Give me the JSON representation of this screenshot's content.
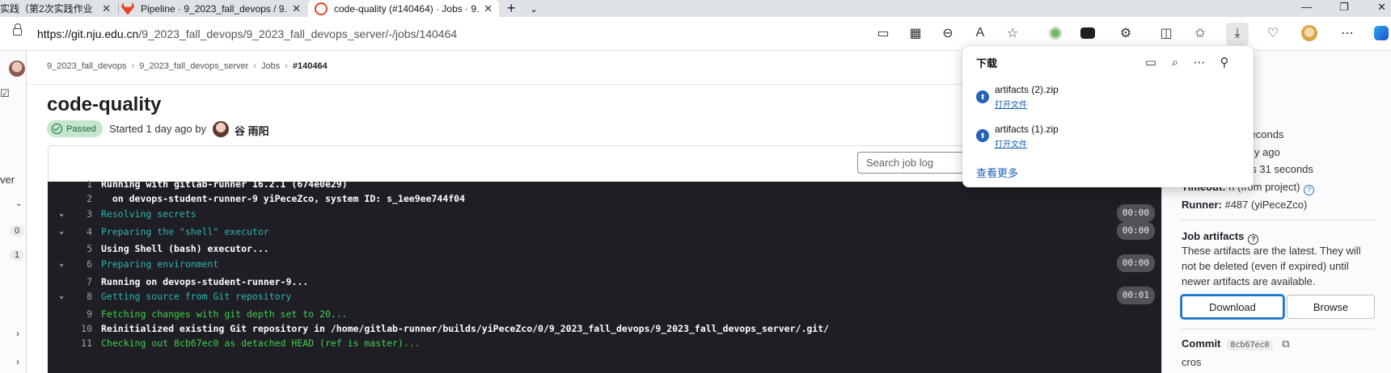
{
  "browser": {
    "tabs": [
      {
        "title": "实践（第2次实践作业",
        "icon_color": "#d9534f"
      },
      {
        "title": "Pipeline · 9_2023_fall_devops / 9.",
        "icon_color": "#e24329"
      },
      {
        "title": "code-quality (#140464) · Jobs · 9.",
        "icon_color": "#e24329",
        "active": true
      }
    ],
    "new_tab_label": "+",
    "tab_list_label": "⌄",
    "url_host": "https://git.nju.edu.cn",
    "url_path": "/9_2023_fall_devops/9_2023_fall_devops_server/-/jobs/140464",
    "toolbar_icons": [
      "app-available-icon",
      "qr-code-icon",
      "zoom-out-icon",
      "read-aloud-icon",
      "favorite-star-icon",
      "extension-green-icon",
      "extension-mask-icon",
      "extensions-icon",
      "split-screen-icon",
      "favorites-icon",
      "downloads-icon",
      "browser-essentials-icon",
      "profile-icon",
      "more-icon",
      "copilot-icon"
    ]
  },
  "sidebar": {
    "labels": [
      "ver"
    ],
    "badges": [
      "0",
      "1"
    ]
  },
  "breadcrumb": [
    "9_2023_fall_devops",
    "9_2023_fall_devops_server",
    "Jobs",
    "#140464"
  ],
  "job": {
    "title": "code-quality",
    "status": "Passed",
    "started": "Started 1 day ago by",
    "user": "谷 雨阳",
    "search_placeholder": "Search job log"
  },
  "log_lines": [
    {
      "n": "1",
      "text": "Running with gitlab-runner 16.2.1 (674e0e29)",
      "style": "bld"
    },
    {
      "n": "2",
      "text": "  on devops-student-runner-9 yiPeceZco, system ID: s_1ee9ee744f04",
      "style": "bld"
    },
    {
      "n": "3",
      "text": "Resolving secrets",
      "style": "sec",
      "dur": "00:00",
      "collapsible": true
    },
    {
      "n": "4",
      "text": "Preparing the \"shell\" executor",
      "style": "sec",
      "dur": "00:00",
      "collapsible": true
    },
    {
      "n": "5",
      "text": "Using Shell (bash) executor...",
      "style": "bld"
    },
    {
      "n": "6",
      "text": "Preparing environment",
      "style": "sec",
      "dur": "00:00",
      "collapsible": true
    },
    {
      "n": "7",
      "text": "Running on devops-student-runner-9...",
      "style": "bld"
    },
    {
      "n": "8",
      "text": "Getting source from Git repository",
      "style": "sec",
      "dur": "00:01",
      "collapsible": true
    },
    {
      "n": "9",
      "text": "Fetching changes with git depth set to 20...",
      "style": "grn"
    },
    {
      "n": "10",
      "text": "Reinitialized existing Git repository in /home/gitlab-runner/builds/yiPeceZco/0/9_2023_fall_devops/9_2023_fall_devops_server/.git/",
      "style": "bld"
    },
    {
      "n": "11",
      "text": "Checking out 8cb67ec0 as detached HEAD (ref is master)...",
      "style": "grn"
    }
  ],
  "right_sidebar": {
    "duration_tail": "seconds",
    "finished_tail": "y ago",
    "queued_tail": "nutes 31 seconds",
    "timeout_label": "Timeout:",
    "timeout_value": "h (from project)",
    "runner_label": "Runner:",
    "runner_value": "#487 (yiPeceZco)",
    "artifacts_title": "Job artifacts",
    "artifacts_desc_1": "These artifacts are the latest. They will",
    "artifacts_desc_2": "not be deleted (even if expired) until",
    "artifacts_desc_3": "newer artifacts are available.",
    "download_label": "Download",
    "browse_label": "Browse",
    "commit_label": "Commit",
    "commit_sha": "8cb67ec0",
    "commit_msg": "cros"
  },
  "downloads": {
    "title": "下载",
    "items": [
      {
        "name": "artifacts (2).zip",
        "action": "打开文件"
      },
      {
        "name": "artifacts (1).zip",
        "action": "打开文件"
      }
    ],
    "more": "查看更多"
  }
}
